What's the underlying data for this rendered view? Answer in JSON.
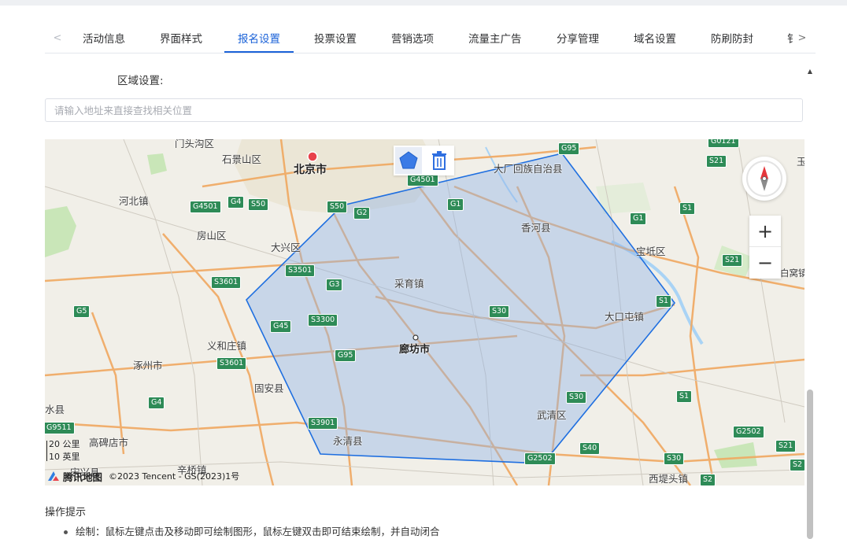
{
  "tabs": {
    "items": [
      {
        "label": "活动信息",
        "active": false
      },
      {
        "label": "界面样式",
        "active": false
      },
      {
        "label": "报名设置",
        "active": true
      },
      {
        "label": "投票设置",
        "active": false
      },
      {
        "label": "营销选项",
        "active": false
      },
      {
        "label": "流量主广告",
        "active": false
      },
      {
        "label": "分享管理",
        "active": false
      },
      {
        "label": "域名设置",
        "active": false
      },
      {
        "label": "防刷防封",
        "active": false
      },
      {
        "label": "钅",
        "active": false
      }
    ],
    "accent": "#1c63d8"
  },
  "region": {
    "label": "区域设置:",
    "search_placeholder": "请输入地址来直接查找相关位置"
  },
  "map": {
    "cities": [
      {
        "name": "门头沟区"
      },
      {
        "name": "石景山区"
      },
      {
        "name": "北京市"
      },
      {
        "name": "大厂回族自治县"
      },
      {
        "name": "河北镇"
      },
      {
        "name": "房山区"
      },
      {
        "name": "大兴区"
      },
      {
        "name": "香河县"
      },
      {
        "name": "宝坻区"
      },
      {
        "name": "采育镇"
      },
      {
        "name": "大口屯镇"
      },
      {
        "name": "义和庄镇"
      },
      {
        "name": "廊坊市"
      },
      {
        "name": "涿州市"
      },
      {
        "name": "固安县"
      },
      {
        "name": "水县"
      },
      {
        "name": "武清区"
      },
      {
        "name": "永清县"
      },
      {
        "name": "高碑店市"
      },
      {
        "name": "宋兴县"
      },
      {
        "name": "辛桥镇"
      },
      {
        "name": "西堤头镇"
      },
      {
        "name": "白窝镇"
      },
      {
        "name": "玉"
      }
    ],
    "roads": [
      "G95",
      "G0121",
      "S21",
      "G4501",
      "G4501",
      "G4",
      "S50",
      "S50",
      "G2",
      "G1",
      "S1",
      "G1",
      "S21",
      "S3501",
      "S3601",
      "G3",
      "S1",
      "G5",
      "S30",
      "G45",
      "S3300",
      "G95",
      "S3601",
      "S30",
      "S1",
      "G4",
      "S3901",
      "G2502",
      "S21",
      "S40",
      "G2502",
      "S30",
      "S2",
      "S2",
      "G9511"
    ],
    "scale": {
      "metric": "20 公里",
      "imperial": "10 英里"
    },
    "logo_text": "腾讯地图",
    "copyright": "©2023 Tencent - GS(2023)1号",
    "polygon_color": "#1f6fe0"
  },
  "tips": {
    "title": "操作提示",
    "items": [
      "绘制：鼠标左键点击及移动即可绘制图形，鼠标左键双击即可结束绘制，并自动闭合"
    ]
  }
}
